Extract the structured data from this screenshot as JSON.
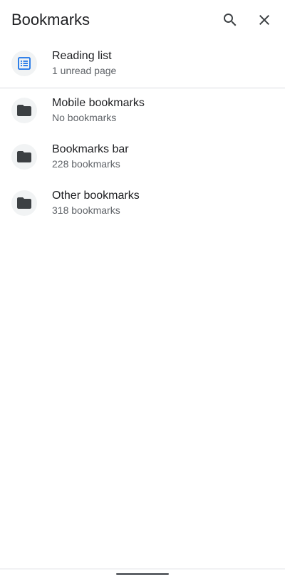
{
  "header": {
    "title": "Bookmarks",
    "search_icon": "search-icon",
    "close_icon": "close-icon"
  },
  "items": [
    {
      "title": "Reading list",
      "subtitle": "1 unread page",
      "icon": "reading-list-icon"
    },
    {
      "title": "Mobile bookmarks",
      "subtitle": "No bookmarks",
      "icon": "folder-icon"
    },
    {
      "title": "Bookmarks bar",
      "subtitle": "228 bookmarks",
      "icon": "folder-icon"
    },
    {
      "title": "Other bookmarks",
      "subtitle": "318 bookmarks",
      "icon": "folder-icon"
    }
  ],
  "colors": {
    "accent": "#1a73e8",
    "text_primary": "#202124",
    "text_secondary": "#5f6368",
    "icon_bg": "#f1f3f4"
  }
}
